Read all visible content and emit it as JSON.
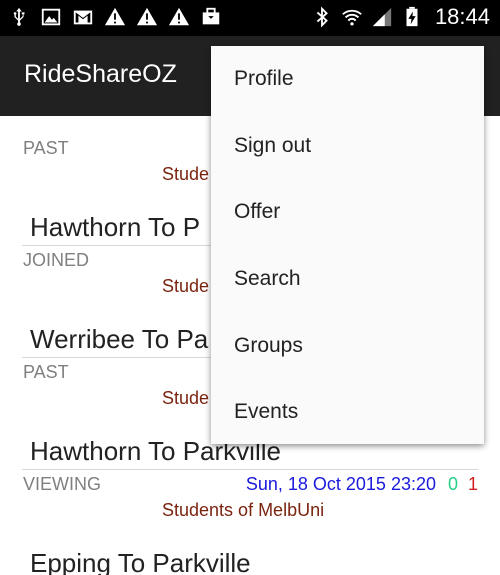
{
  "status_bar": {
    "time": "18:44",
    "left_icons": [
      "usb-icon",
      "image-icon",
      "gmail-icon",
      "warning-icon",
      "warning-icon",
      "warning-icon",
      "briefcase-icon"
    ],
    "right_icons": [
      "bluetooth-icon",
      "wifi-icon",
      "signal-icon",
      "battery-charging-icon"
    ]
  },
  "app_bar": {
    "title": "RideShareOZ"
  },
  "rides": [
    {
      "status": "PAST",
      "group": "Stude",
      "route": "Hawthorn To  P",
      "date": "",
      "count_a": "",
      "count_b": ""
    },
    {
      "status": "JOINED",
      "group": "Stude",
      "route": "Werribee To  Pa",
      "date": "",
      "count_a": "",
      "count_b": ""
    },
    {
      "status": "PAST",
      "group": "Stude",
      "route": "Hawthorn To  Parkville",
      "date": "",
      "count_a": "",
      "count_b": ""
    },
    {
      "status": "VIEWING",
      "group": "Students of MelbUni",
      "route": "Epping To  Parkville",
      "date": "Sun, 18 Oct 2015 23:20",
      "count_a": "0",
      "count_b": "1"
    }
  ],
  "menu": {
    "items": [
      "Profile",
      "Sign out",
      "Offer",
      "Search",
      "Groups",
      "Events"
    ]
  },
  "colors": {
    "status_bar": "#000000",
    "app_bar": "#212121",
    "status_text": "#808080",
    "date_text": "#1a1adc",
    "count_a": "#27d08a",
    "count_b": "#d02020",
    "group_text": "#7a2410"
  }
}
